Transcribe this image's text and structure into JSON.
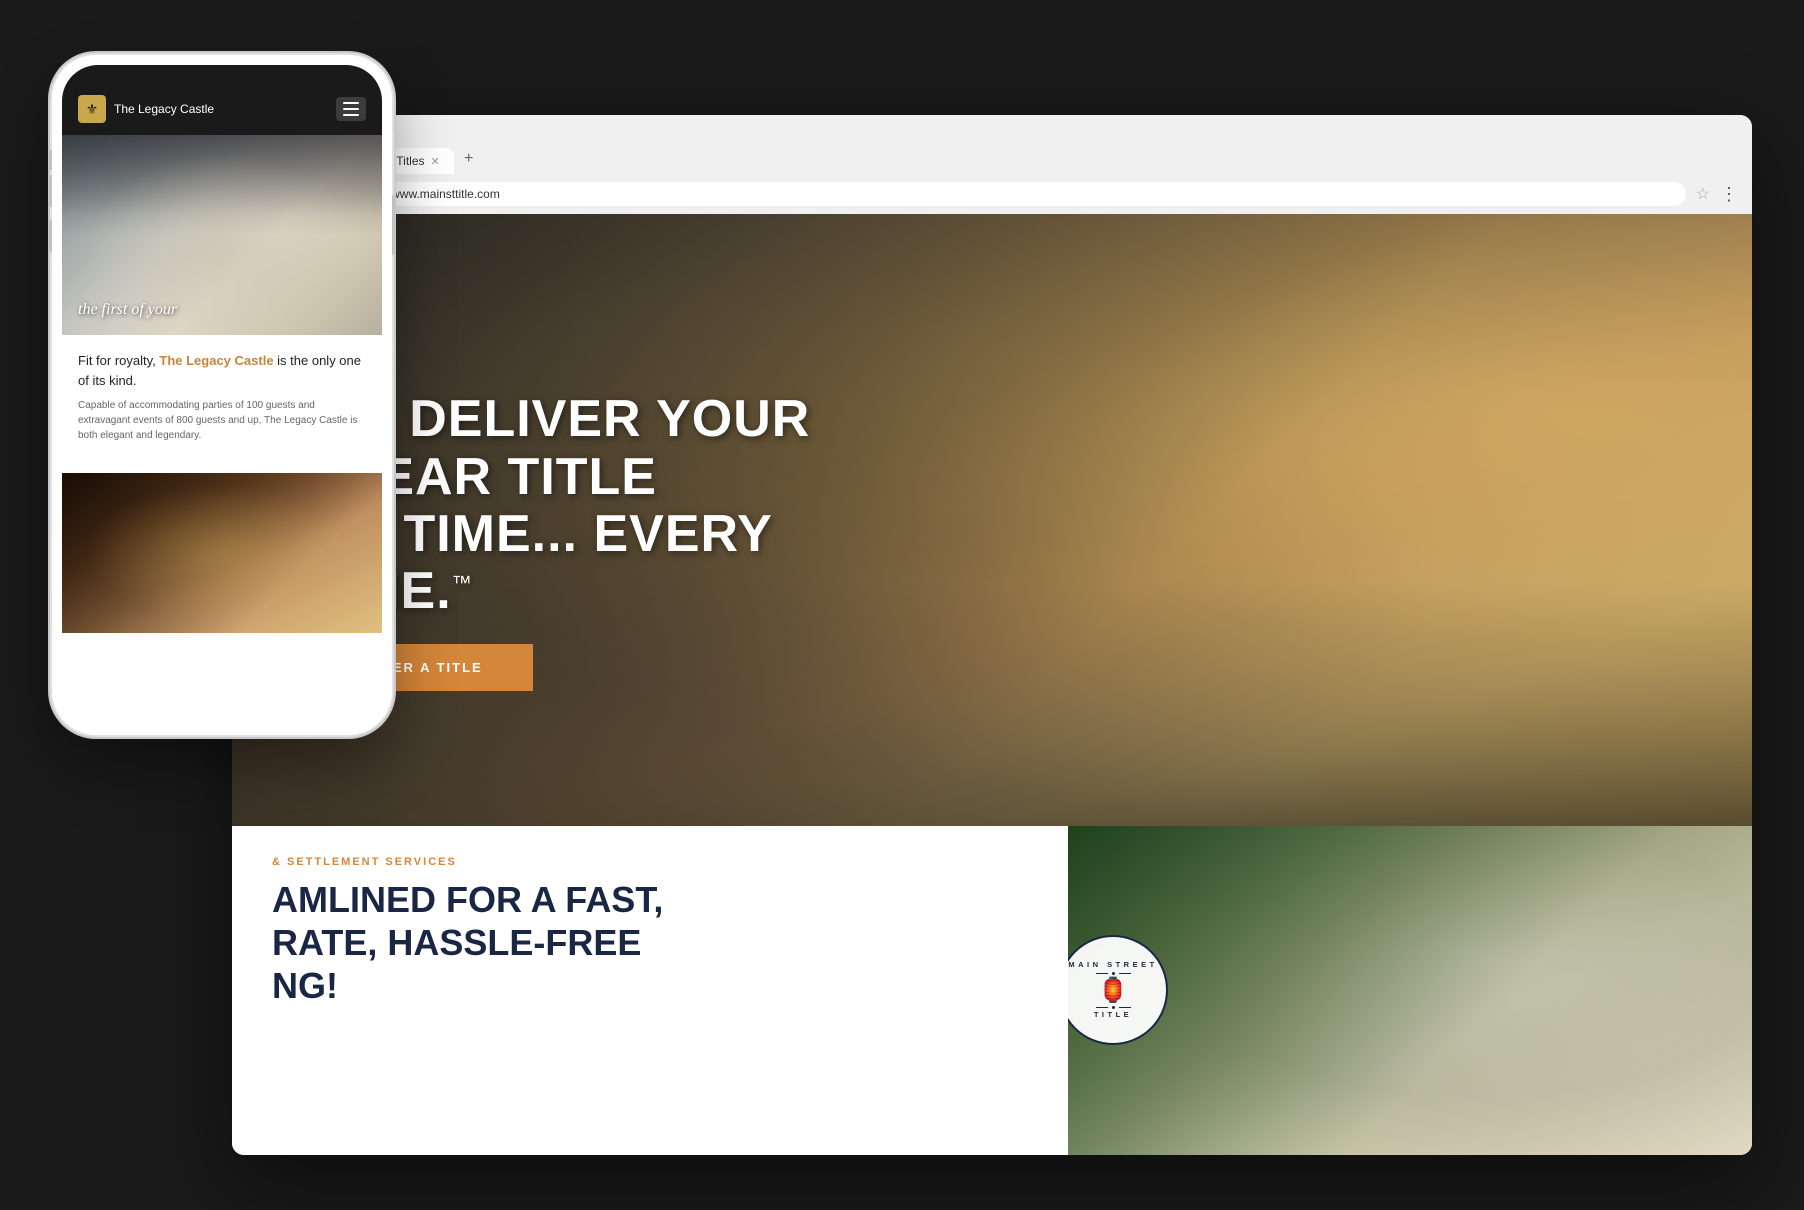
{
  "browser": {
    "tab_label": "Main Street Title | NJ Titles",
    "tab_favicon": "🏠",
    "url": "https://www.mainsttitle.com",
    "nav_back": "←",
    "nav_forward": "→",
    "nav_refresh": "↻"
  },
  "hero": {
    "headline_line1": "WE DELIVER YOUR CLEAR TITLE",
    "headline_line2": "ON TIME... EVERY TIME.",
    "trademark": "™",
    "cta_label": "ORDER A TITLE"
  },
  "below_fold": {
    "service_tag": "& SETTLEMENT SERVICES",
    "headline_line1": "AMLINED FOR A FAST,",
    "headline_line2": "RATE, HASSLE-FREE",
    "headline_line3": "NG!"
  },
  "badge": {
    "arc_top": "MAIN STREET",
    "arc_bottom": "TITLE",
    "icon": "🏮"
  },
  "phone": {
    "logo_text": "The Legacy Castle",
    "logo_icon": "⚜",
    "hero_overlay_text": "the first of your",
    "body_text_prefix": "Fit for royalty, ",
    "body_highlight": "The Legacy Castle",
    "body_text_suffix": " is the only one of its kind.",
    "body_desc": "Capable of accommodating parties of 100 guests and extravagant events of 800 guests and up, The Legacy Castle is both elegant and legendary."
  }
}
